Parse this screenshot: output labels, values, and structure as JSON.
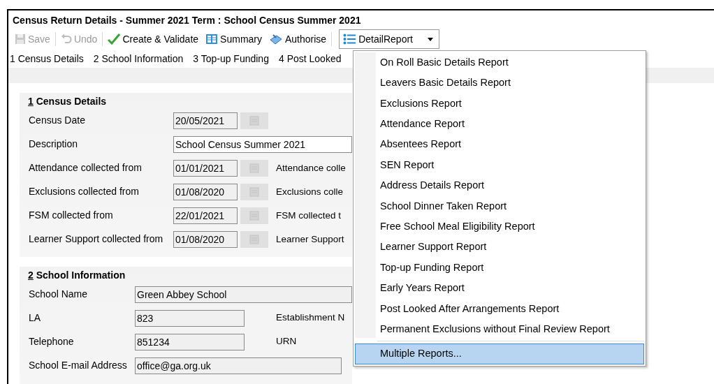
{
  "window": {
    "title": "Census Return Details - Summer 2021 Term : School Census Summer 2021"
  },
  "toolbar": {
    "buttons": [
      {
        "kind": "save",
        "label": "Save",
        "disabled": true
      },
      {
        "kind": "undo",
        "label": "Undo",
        "disabled": true
      },
      {
        "kind": "validate",
        "label": "Create & Validate",
        "disabled": false
      },
      {
        "kind": "summary",
        "label": "Summary",
        "disabled": false
      },
      {
        "kind": "authorise",
        "label": "Authorise",
        "disabled": false
      }
    ],
    "dropdown": {
      "label": "DetailReport",
      "expanded": true
    }
  },
  "nav_links": [
    "1 Census Details",
    "2 School Information",
    "3 Top-up Funding",
    "4 Post Looked"
  ],
  "sections": [
    {
      "number": "1",
      "title": "Census Details",
      "fields": [
        {
          "kind": "date",
          "label": "Census Date",
          "value": "20/05/2021"
        },
        {
          "kind": "text",
          "label": "Description",
          "value": "School Census Summer 2021",
          "disabled": false
        },
        {
          "kind": "date",
          "label": "Attendance collected from",
          "value": "01/01/2021",
          "right_label": "Attendance colle"
        },
        {
          "kind": "date",
          "label": "Exclusions collected from",
          "value": "01/08/2020",
          "right_label": "Exclusions colle"
        },
        {
          "kind": "date",
          "label": "FSM collected from",
          "value": "22/01/2021",
          "right_label": "FSM collected t"
        },
        {
          "kind": "date",
          "label": "Learner Support collected from",
          "value": "01/08/2020",
          "right_label": "Learner Support"
        }
      ]
    },
    {
      "number": "2",
      "title": "School Information",
      "fields": [
        {
          "kind": "text",
          "label": "School Name",
          "value": "Green Abbey School",
          "disabled": true
        },
        {
          "kind": "short",
          "label": "LA",
          "value": "823",
          "right_label": "Establishment N"
        },
        {
          "kind": "short",
          "label": "Telephone",
          "value": "851234",
          "right_label": "URN"
        },
        {
          "kind": "email",
          "label": "School E-mail Address",
          "value": "office@ga.org.uk"
        }
      ]
    }
  ],
  "menu": {
    "items": [
      {
        "label": "On Roll Basic Details Report",
        "selected": false
      },
      {
        "label": "Leavers Basic Details Report",
        "selected": false
      },
      {
        "label": "Exclusions Report",
        "selected": false
      },
      {
        "label": "Attendance Report",
        "selected": false
      },
      {
        "label": "Absentees Report",
        "selected": false
      },
      {
        "label": "SEN Report",
        "selected": false
      },
      {
        "label": "Address Details Report",
        "selected": false
      },
      {
        "label": "School Dinner Taken Report",
        "selected": false
      },
      {
        "label": "Free School Meal Eligibility Report",
        "selected": false
      },
      {
        "label": "Learner Support Report",
        "selected": false
      },
      {
        "label": "Top-up Funding Report",
        "selected": false
      },
      {
        "label": "Early Years Report",
        "selected": false
      },
      {
        "label": "Post Looked After Arrangements Report",
        "selected": false
      },
      {
        "label": "Permanent Exclusions without Final Review Report",
        "selected": false
      },
      {
        "label": "Multiple Reports...",
        "selected": true,
        "separated": true
      }
    ]
  }
}
